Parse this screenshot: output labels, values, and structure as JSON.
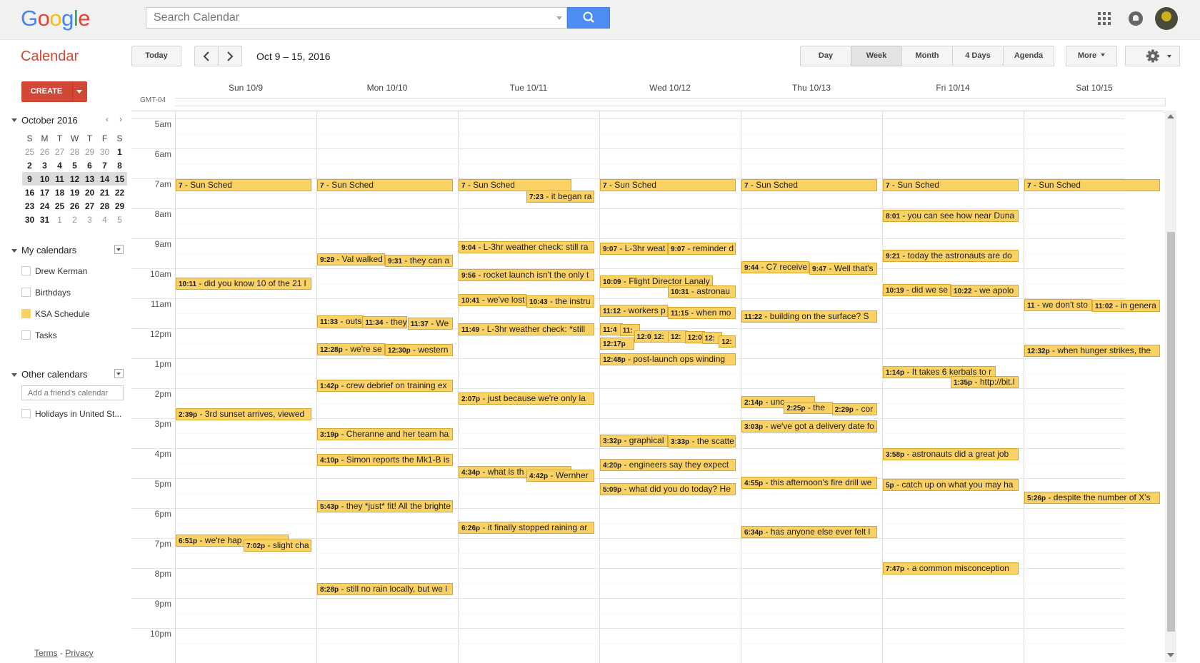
{
  "header": {
    "logo": "Google",
    "search_placeholder": "Search Calendar",
    "search_button_icon": "search-icon",
    "apps_icon": "apps-grid-icon",
    "notifications_icon": "bell-icon",
    "account_icon": "avatar"
  },
  "toolbar": {
    "title": "Calendar",
    "today": "Today",
    "prev_icon": "chevron-left-icon",
    "next_icon": "chevron-right-icon",
    "date_range": "Oct 9 – 15, 2016",
    "views": [
      "Day",
      "Week",
      "Month",
      "4 Days",
      "Agenda"
    ],
    "selected_view": "Week",
    "more": "More",
    "settings_icon": "gear-icon"
  },
  "sidebar": {
    "create": "CREATE",
    "mini_cal": {
      "title": "October 2016",
      "weekdays": [
        "S",
        "M",
        "T",
        "W",
        "T",
        "F",
        "S"
      ],
      "weeks": [
        [
          "25",
          "26",
          "27",
          "28",
          "29",
          "30",
          "1"
        ],
        [
          "2",
          "3",
          "4",
          "5",
          "6",
          "7",
          "8"
        ],
        [
          "9",
          "10",
          "11",
          "12",
          "13",
          "14",
          "15"
        ],
        [
          "16",
          "17",
          "18",
          "19",
          "20",
          "21",
          "22"
        ],
        [
          "23",
          "24",
          "25",
          "26",
          "27",
          "28",
          "29"
        ],
        [
          "30",
          "31",
          "1",
          "2",
          "3",
          "4",
          "5"
        ]
      ]
    },
    "my_calendars": {
      "title": "My calendars",
      "items": [
        "Drew Kerman",
        "Birthdays",
        "KSA Schedule",
        "Tasks"
      ]
    },
    "other_calendars": {
      "title": "Other calendars",
      "add_placeholder": "Add a friend's calendar",
      "items": [
        "Holidays in United St..."
      ]
    },
    "footer": {
      "terms": "Terms",
      "sep": " - ",
      "privacy": "Privacy"
    }
  },
  "week": {
    "timezone": "GMT-04",
    "days": [
      "Sun 10/9",
      "Mon 10/10",
      "Tue 10/11",
      "Wed 10/12",
      "Thu 10/13",
      "Fri 10/14",
      "Sat 10/15"
    ],
    "hours": [
      "5am",
      "6am",
      "7am",
      "8am",
      "9am",
      "10am",
      "11am",
      "12pm",
      "1pm",
      "2pm",
      "3pm",
      "4pm",
      "5pm",
      "6pm",
      "7pm",
      "8pm",
      "9pm",
      "10pm"
    ]
  },
  "events": [
    {
      "day": 0,
      "start": 7.0,
      "col": 0,
      "cols": 1,
      "w": 0.96,
      "time": "7",
      "text": " - Sun Sched"
    },
    {
      "day": 1,
      "start": 7.0,
      "col": 0,
      "cols": 1,
      "w": 0.96,
      "time": "7",
      "text": " - Sun Sched"
    },
    {
      "day": 2,
      "start": 7.0,
      "col": 0,
      "cols": 1,
      "w": 0.8,
      "time": "7",
      "text": " - Sun Sched"
    },
    {
      "day": 3,
      "start": 7.0,
      "col": 0,
      "cols": 1,
      "w": 0.96,
      "time": "7",
      "text": " - Sun Sched"
    },
    {
      "day": 4,
      "start": 7.0,
      "col": 0,
      "cols": 1,
      "w": 0.96,
      "time": "7",
      "text": " - Sun Sched"
    },
    {
      "day": 5,
      "start": 7.0,
      "col": 0,
      "cols": 1,
      "w": 0.96,
      "time": "7",
      "text": " - Sun Sched"
    },
    {
      "day": 6,
      "start": 7.0,
      "col": 0,
      "cols": 1,
      "w": 0.96,
      "time": "7",
      "text": " - Sun Sched"
    },
    {
      "day": 2,
      "start": 7.38,
      "col": 0.48,
      "cols": 1,
      "w": 0.48,
      "time": "7:23",
      "text": " - it began ra"
    },
    {
      "day": 5,
      "start": 8.02,
      "col": 0,
      "cols": 1,
      "w": 0.96,
      "time": "8:01",
      "text": " - you can see how near Duna"
    },
    {
      "day": 2,
      "start": 9.07,
      "col": 0,
      "cols": 1,
      "w": 0.96,
      "time": "9:04",
      "text": " - L-3hr weather check: still ra"
    },
    {
      "day": 3,
      "start": 9.12,
      "col": 0,
      "cols": 1,
      "w": 0.48,
      "time": "9:07",
      "text": " - L-3hr weat"
    },
    {
      "day": 3,
      "start": 9.12,
      "col": 0.48,
      "cols": 1,
      "w": 0.48,
      "time": "9:07",
      "text": " - reminder d"
    },
    {
      "day": 1,
      "start": 9.48,
      "col": 0,
      "cols": 1,
      "w": 0.48,
      "time": "9:29",
      "text": " - Val walked"
    },
    {
      "day": 1,
      "start": 9.52,
      "col": 0.48,
      "cols": 1,
      "w": 0.48,
      "time": "9:31",
      "text": " - they can a"
    },
    {
      "day": 5,
      "start": 9.35,
      "col": 0,
      "cols": 1,
      "w": 0.96,
      "time": "9:21",
      "text": " - today the astronauts are do"
    },
    {
      "day": 4,
      "start": 9.73,
      "col": 0,
      "cols": 1,
      "w": 0.48,
      "time": "9:44",
      "text": " - C7 receive"
    },
    {
      "day": 4,
      "start": 9.78,
      "col": 0.48,
      "cols": 1,
      "w": 0.48,
      "time": "9:47",
      "text": " - Well that's"
    },
    {
      "day": 2,
      "start": 10.0,
      "col": 0,
      "cols": 1,
      "w": 0.96,
      "time": "9:56",
      "text": " - rocket launch isn't the only t"
    },
    {
      "day": 3,
      "start": 10.22,
      "col": 0,
      "cols": 1,
      "w": 0.8,
      "time": "10:09",
      "text": " - Flight Director Lanaly"
    },
    {
      "day": 0,
      "start": 10.28,
      "col": 0,
      "cols": 1,
      "w": 0.96,
      "time": "10:11",
      "text": " - did you know 10 of the 21 l"
    },
    {
      "day": 3,
      "start": 10.55,
      "col": 0.48,
      "cols": 1,
      "w": 0.48,
      "time": "10:31",
      "text": " - astronau"
    },
    {
      "day": 5,
      "start": 10.5,
      "col": 0,
      "cols": 1,
      "w": 0.48,
      "time": "10:19",
      "text": " - did we se"
    },
    {
      "day": 5,
      "start": 10.53,
      "col": 0.48,
      "cols": 1,
      "w": 0.48,
      "time": "10:22",
      "text": " - we apolo"
    },
    {
      "day": 2,
      "start": 10.83,
      "col": 0,
      "cols": 1,
      "w": 0.48,
      "time": "10:41",
      "text": " - we've lost"
    },
    {
      "day": 2,
      "start": 10.87,
      "col": 0.48,
      "cols": 1,
      "w": 0.48,
      "time": "10:43",
      "text": " - the instru"
    },
    {
      "day": 6,
      "start": 11.0,
      "col": 0,
      "cols": 1,
      "w": 0.48,
      "time": "11",
      "text": " - we don't sto"
    },
    {
      "day": 6,
      "start": 11.03,
      "col": 0.48,
      "cols": 1,
      "w": 0.48,
      "time": "11:02",
      "text": " - in genera"
    },
    {
      "day": 3,
      "start": 11.2,
      "col": 0,
      "cols": 1,
      "w": 0.48,
      "time": "11:12",
      "text": " - workers p"
    },
    {
      "day": 3,
      "start": 11.25,
      "col": 0.48,
      "cols": 1,
      "w": 0.48,
      "time": "11:15",
      "text": " - when mo"
    },
    {
      "day": 4,
      "start": 11.37,
      "col": 0,
      "cols": 1,
      "w": 0.96,
      "time": "11:22",
      "text": " - building on the surface? S"
    },
    {
      "day": 1,
      "start": 11.55,
      "col": 0,
      "cols": 1,
      "w": 0.33,
      "time": "11:33",
      "text": " - outs"
    },
    {
      "day": 1,
      "start": 11.57,
      "col": 0.32,
      "cols": 1,
      "w": 0.32,
      "time": "11:34",
      "text": " - they"
    },
    {
      "day": 1,
      "start": 11.62,
      "col": 0.64,
      "cols": 1,
      "w": 0.32,
      "time": "11:37",
      "text": " - We"
    },
    {
      "day": 2,
      "start": 11.82,
      "col": 0,
      "cols": 1,
      "w": 0.96,
      "time": "11:49",
      "text": " - L-3hr weather check: *still"
    },
    {
      "day": 3,
      "start": 11.8,
      "col": 0,
      "cols": 1,
      "w": 0.16,
      "time": "11:4",
      "text": ""
    },
    {
      "day": 3,
      "start": 11.83,
      "col": 0.14,
      "cols": 1,
      "w": 0.14,
      "time": "11:",
      "text": ""
    },
    {
      "day": 3,
      "start": 12.05,
      "col": 0.24,
      "cols": 1,
      "w": 0.14,
      "time": "12:0",
      "text": ""
    },
    {
      "day": 3,
      "start": 12.05,
      "col": 0.36,
      "cols": 1,
      "w": 0.14,
      "time": "12:",
      "text": ""
    },
    {
      "day": 3,
      "start": 12.05,
      "col": 0.48,
      "cols": 1,
      "w": 0.14,
      "time": "12:",
      "text": ""
    },
    {
      "day": 3,
      "start": 12.08,
      "col": 0.6,
      "cols": 1,
      "w": 0.14,
      "time": "12:0",
      "text": ""
    },
    {
      "day": 3,
      "start": 12.1,
      "col": 0.72,
      "cols": 1,
      "w": 0.14,
      "time": "12:",
      "text": ""
    },
    {
      "day": 3,
      "start": 12.22,
      "col": 0.84,
      "cols": 1,
      "w": 0.12,
      "time": "12:",
      "text": ""
    },
    {
      "day": 3,
      "start": 12.28,
      "col": 0,
      "cols": 1,
      "w": 0.24,
      "time": "12:17p",
      "text": ""
    },
    {
      "day": 1,
      "start": 12.47,
      "col": 0,
      "cols": 1,
      "w": 0.48,
      "time": "12:28p",
      "text": " - we're se"
    },
    {
      "day": 1,
      "start": 12.5,
      "col": 0.48,
      "cols": 1,
      "w": 0.48,
      "time": "12:30p",
      "text": " - western"
    },
    {
      "day": 6,
      "start": 12.53,
      "col": 0,
      "cols": 1,
      "w": 0.96,
      "time": "12:32p",
      "text": " - when hunger strikes, the"
    },
    {
      "day": 3,
      "start": 12.8,
      "col": 0,
      "cols": 1,
      "w": 0.96,
      "time": "12:48p",
      "text": " - post-launch ops winding"
    },
    {
      "day": 5,
      "start": 13.23,
      "col": 0,
      "cols": 1,
      "w": 0.8,
      "time": "1:14p",
      "text": " - It takes 6 kerbals to r"
    },
    {
      "day": 5,
      "start": 13.58,
      "col": 0.48,
      "cols": 1,
      "w": 0.48,
      "time": "1:35p",
      "text": " - http://bit.l"
    },
    {
      "day": 1,
      "start": 13.7,
      "col": 0,
      "cols": 1,
      "w": 0.96,
      "time": "1:42p",
      "text": " - crew debrief on training ex"
    },
    {
      "day": 2,
      "start": 14.12,
      "col": 0,
      "cols": 1,
      "w": 0.96,
      "time": "2:07p",
      "text": " - just because we're only la"
    },
    {
      "day": 4,
      "start": 14.23,
      "col": 0,
      "cols": 1,
      "w": 0.52,
      "time": "2:14p",
      "text": " - unc"
    },
    {
      "day": 4,
      "start": 14.42,
      "col": 0.3,
      "cols": 1,
      "w": 0.35,
      "time": "2:25p",
      "text": " - the"
    },
    {
      "day": 4,
      "start": 14.48,
      "col": 0.64,
      "cols": 1,
      "w": 0.32,
      "time": "2:29p",
      "text": " - cor"
    },
    {
      "day": 0,
      "start": 14.65,
      "col": 0,
      "cols": 1,
      "w": 0.96,
      "time": "2:39p",
      "text": " - 3rd sunset arrives, viewed"
    },
    {
      "day": 4,
      "start": 15.05,
      "col": 0,
      "cols": 1,
      "w": 0.96,
      "time": "3:03p",
      "text": " - we've got a delivery date fo"
    },
    {
      "day": 1,
      "start": 15.32,
      "col": 0,
      "cols": 1,
      "w": 0.96,
      "time": "3:19p",
      "text": " - Cheranne and her team ha"
    },
    {
      "day": 3,
      "start": 15.53,
      "col": 0,
      "cols": 1,
      "w": 0.48,
      "time": "3:32p",
      "text": " - graphical"
    },
    {
      "day": 3,
      "start": 15.55,
      "col": 0.48,
      "cols": 1,
      "w": 0.48,
      "time": "3:33p",
      "text": " - the scatte"
    },
    {
      "day": 5,
      "start": 15.97,
      "col": 0,
      "cols": 1,
      "w": 0.96,
      "time": "3:58p",
      "text": " - astronauts did a great job"
    },
    {
      "day": 1,
      "start": 16.17,
      "col": 0,
      "cols": 1,
      "w": 0.96,
      "time": "4:10p",
      "text": " - Simon reports the Mk1-B is"
    },
    {
      "day": 3,
      "start": 16.33,
      "col": 0,
      "cols": 1,
      "w": 0.96,
      "time": "4:20p",
      "text": " - engineers say they expect"
    },
    {
      "day": 2,
      "start": 16.57,
      "col": 0,
      "cols": 1,
      "w": 0.8,
      "time": "4:34p",
      "text": " - what is th"
    },
    {
      "day": 2,
      "start": 16.7,
      "col": 0.48,
      "cols": 1,
      "w": 0.48,
      "time": "4:42p",
      "text": " - Wernher"
    },
    {
      "day": 4,
      "start": 16.92,
      "col": 0,
      "cols": 1,
      "w": 0.96,
      "time": "4:55p",
      "text": " - this afternoon's fire drill we"
    },
    {
      "day": 5,
      "start": 17.0,
      "col": 0,
      "cols": 1,
      "w": 0.96,
      "time": "5p",
      "text": " - catch up on what you may ha"
    },
    {
      "day": 3,
      "start": 17.15,
      "col": 0,
      "cols": 1,
      "w": 0.96,
      "time": "5:09p",
      "text": " - what did you do today? He"
    },
    {
      "day": 6,
      "start": 17.43,
      "col": 0,
      "cols": 1,
      "w": 0.96,
      "time": "5:26p",
      "text": " - despite the number of X's"
    },
    {
      "day": 1,
      "start": 17.72,
      "col": 0,
      "cols": 1,
      "w": 0.96,
      "time": "5:43p",
      "text": " - they *just* fit! All the brighte"
    },
    {
      "day": 2,
      "start": 18.43,
      "col": 0,
      "cols": 1,
      "w": 0.96,
      "time": "6:26p",
      "text": " - it finally stopped raining ar"
    },
    {
      "day": 4,
      "start": 18.57,
      "col": 0,
      "cols": 1,
      "w": 0.96,
      "time": "6:34p",
      "text": " - has anyone else ever felt l"
    },
    {
      "day": 0,
      "start": 18.85,
      "col": 0,
      "cols": 1,
      "w": 0.8,
      "time": "6:51p",
      "text": " - we're hap"
    },
    {
      "day": 0,
      "start": 19.03,
      "col": 0.48,
      "cols": 1,
      "w": 0.48,
      "time": "7:02p",
      "text": " - slight cha"
    },
    {
      "day": 5,
      "start": 19.78,
      "col": 0,
      "cols": 1,
      "w": 0.96,
      "time": "7:47p",
      "text": " - a common misconception"
    },
    {
      "day": 1,
      "start": 20.47,
      "col": 0,
      "cols": 1,
      "w": 0.96,
      "time": "8:28p",
      "text": " - still no rain locally, but we l"
    }
  ],
  "colors": {
    "event_bg": "#fad165",
    "event_border": "#d5a72c",
    "accent": "#d14836",
    "search_button": "#4d8cf2"
  }
}
